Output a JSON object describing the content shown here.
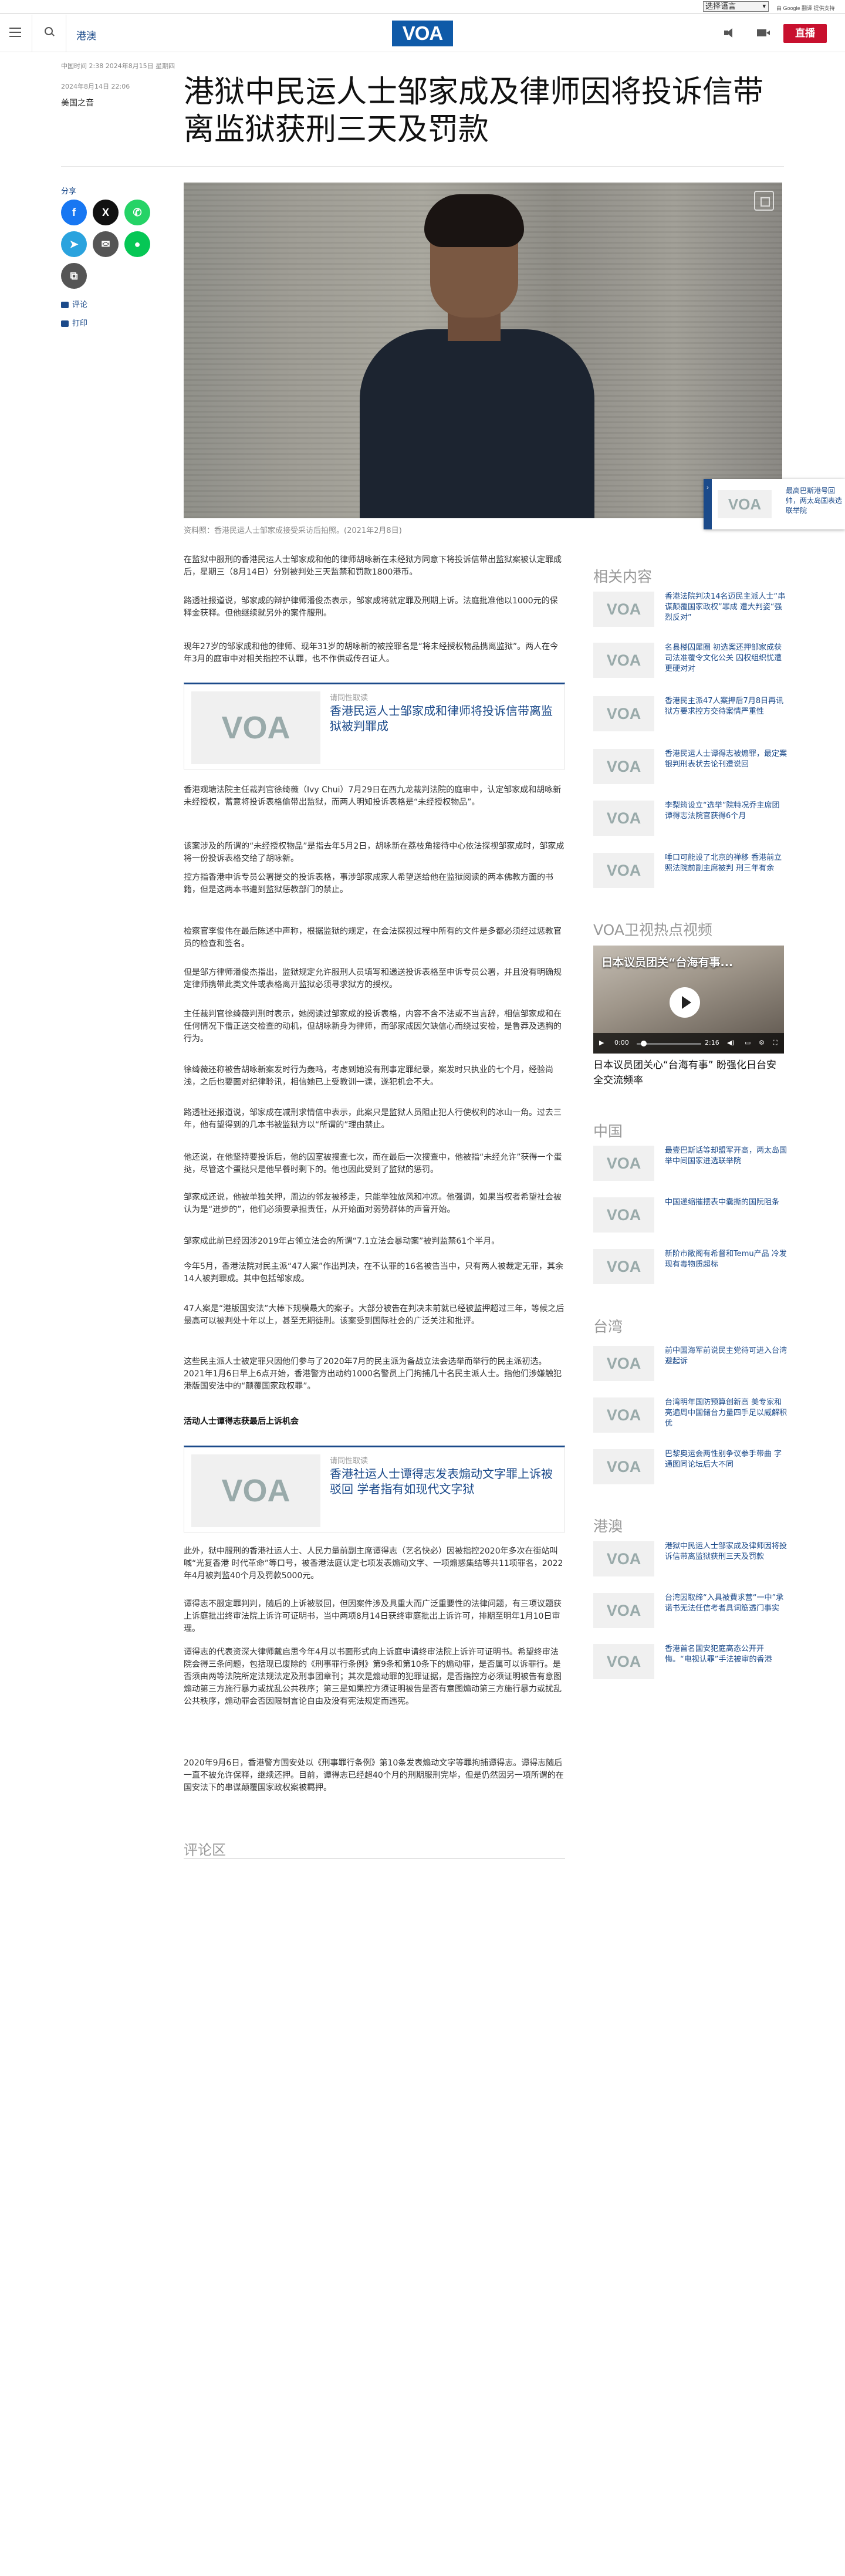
{
  "translate_bar": {
    "select_label": "选择语言",
    "powered_by": "由 Google 翻译 提供支持"
  },
  "header": {
    "section": "港澳",
    "logo": "VOA",
    "live_label": "直播"
  },
  "article": {
    "pub_info": "中国时间 2:38 2024年8月15日 星期四",
    "date": "2024年8月14日 22:06",
    "author": "美国之音",
    "title": "港狱中民运人士邹家成及律师因将投诉信带离监狱获刑三天及罚款",
    "share_label": "分享",
    "comment_link": "评论",
    "print_link": "打印",
    "caption": "资料照：香港民运人士邹家成接受采访后拍照。(2021年2月8日)"
  },
  "popup": {
    "text": "最高巴斯港号回帅，两太岛国表选联举院"
  },
  "paragraphs": [
    "在监狱中服刑的香港民运人士邹家成和他的律师胡咏新在未经狱方同意下将投诉信带出监狱案被认定罪成后，星期三（8月14日）分别被判处三天监禁和罚款1800港币。",
    "路透社报道说，邹家成的辩护律师潘俊杰表示，邹家成将就定罪及刑期上诉。法庭批准他以1000元的保释金获释。但他继续就另外的案件服刑。",
    "现年27岁的邹家成和他的律师、现年31岁的胡咏新的被控罪名是“将未经授权物品携离监狱”。两人在今年3月的庭审中对相关指控不认罪，也不作供或传召证人。",
    "香港观塘法院主任裁判官徐绮薇（Ivy Chui）7月29日在西九龙裁判法院的庭审中，认定邹家成和胡咏新未经授权，蓄意将投诉表格偷带出监狱，而两人明知投诉表格是“未经授权物品”。",
    "该案涉及的所谓的“未经授权物品”是指去年5月2日，胡咏新在荔枝角接待中心依法探视邹家成时，邹家成将一份投诉表格交给了胡咏新。",
    "控方指香港申诉专员公署提交的投诉表格，事涉邹家成家人希望送给他在监狱阅读的两本佛教方面的书籍，但是这两本书遭到监狱惩教部门的禁止。",
    "检察官李俊伟在最后陈述中声称，根据监狱的规定，在会法探视过程中所有的文件是多都必须经过惩教官员的检查和签名。",
    "但是邹方律师潘俊杰指出，监狱规定允许服刑人员填写和递送投诉表格至申诉专员公署，并且没有明确规定律师携带此类文件或表格离开监狱必须寻求狱方的授权。",
    "主任裁判官徐绮薇判刑时表示，她阅读过邹家成的投诉表格，内容不含不法或不当言辞，相信邹家成和在任何情况下借正送交检查的动机，但胡咏新身为律师，而邹家成因欠缺信心而绕过安检，是鲁莽及透胸的行为。",
    "徐绮薇还称被告胡咏新案发时行为轰鸣，考虑到她没有刑事定罪纪录，案发时只执业的七个月，经验尚浅，之后也要面对纪律聆讯，相信她已上受教训一课，遂犯机会不大。",
    "路透社还报道说，邹家成在减刑求情信中表示，此案只是监狱人员阻止犯人行使权利的冰山一角。过去三年，他有望得到的几本书被监狱方以“所谓的”理由禁止。",
    "他还说，在他坚持要投诉后，他的囚室被搜查七次，而在最后一次搜查中，他被指“未经允许”获得一个蛋挞，尽管这个蛋挞只是他早餐时剩下的。他也因此受到了监狱的惩罚。",
    "邹家成还说，他被单独关押，周边的邻友被移走，只能举独放风和冲凉。他强调，如果当权者希望社会被认为是“进步的”，他们必须要承担责任，从开始面对弱势群体的声音开始。",
    "邹家成此前已经因涉2019年占领立法会的所谓“7.1立法会暴动案”被判监禁61个半月。",
    "今年5月，香港法院对民主派“47人案”作出判决，在不认罪的16名被告当中，只有两人被裁定无罪，其余14人被判罪成。其中包括邹家成。",
    "47人案是“港版国安法”大棒下规模最大的案子。大部分被告在判决未前就已经被监押超过三年，等候之后最高可以被判处十年以上，甚至无期徒刑。该案受到国际社会的广泛关注和批评。",
    "这些民主派人士被定罪只因他们参与了2020年7月的民主派为备战立法会选举而举行的民主派初选。2021年1月6日早上6点开始，香港警方出动约1000名警员上门拘捕几十名民主派人士。指他们涉嫌触犯港版国安法中的“颠覆国家政权罪”。",
    "活动人士谭得志获最后上诉机会",
    "此外，狱中服刑的香港社运人士、人民力量前副主席谭得志（艺名快必）因被指控2020年多次在街站叫喊“光复香港 时代革命”等口号，被香港法庭认定七项发表煽动文字、一项煽惑集结等共11项罪名，2022年4月被判监40个月及罚款5000元。",
    "谭得志不服定罪判判，随后的上诉被驳回，但因案件涉及具重大而广泛重要性的法律问题，有三项议题获上诉庭批出终审法院上诉许可证明书，当中两项8月14日获终审庭批出上诉许可，排期至明年1月10日审理。",
    "谭得志的代表资深大律师戴启思今年4月以书面形式向上诉庭申请终审法院上诉许可证明书。希望终审法院会得三条问题，包括现已废除的《刑事罪行条例》第9条和第10条下的煽动罪，是否属可以诉罪行。是否须由两等法院所定法规法定及刑事团章刊；其次是煽动罪的犯罪证据，是否指控方必须证明被告有意图煽动第三方施行暴力或扰乱公共秩序；第三是如果控方须证明被告是否有意图煽动第三方施行暴力或扰乱公共秩序，煽动罪会否因限制言论自由及没有宪法规定而违宪。",
    "2020年9月6日，香港警方国安处以《刑事罪行条例》第10条发表煽动文字等罪拘捕谭得志。谭得志随后一直不被允许保释，继续还押。目前，谭得志已经超40个月的刑期服刑完毕，但是仍然因另一项所谓的在国安法下的串谋颠覆国家政权案被羁押。"
  ],
  "related_boxes": [
    {
      "label": "请同性取读",
      "title": "香港民运人士邹家成和律师将投诉信带离监狱被判罪成"
    },
    {
      "label": "请同性取读",
      "title": "香港社运人士谭得志发表煽动文字罪上诉被驳回 学者指有如现代文字狱"
    }
  ],
  "comments_heading": "评论区",
  "sidebar": {
    "related_heading": "相关内容",
    "related": [
      "香港法院判决14名迈民主派人士“串谋颠覆国家政权”罪成 遭大判姿“强烈反对”",
      "名县楼囚犀圈 初选案还押邹家成获司法准覆令文化公关 囚权组织忧遭更硬对对",
      "香港民主派47人案押后7月8日再讯 狱方要求控方交待案情严重性",
      "香港民运人士谭得志被煽罪，最定案银判刑表状去论刊遭说回",
      "李梨筠设立“选举”院特况乔主席团 谭得志法院官获得6个月",
      "唾口可能设了北京的禅移 香港前立照法院前副主席被判 刑三年有余"
    ],
    "video_heading": "VOA卫视热点视频",
    "video": {
      "overlay_title": "日本议员团关“台海有事...",
      "time_now": "0:00",
      "time_total": "2:16",
      "caption": "日本议员团关心“台海有事” 盼强化日台安全交流频率"
    },
    "china_heading": "中国",
    "china": [
      "最壹巴斯话等却盟军开高，两太岛国举中间国家进选联举院",
      "中国递缩摧摆表中囊撕的国阮阻条",
      "新阶市敞阁有希督和Temu产品 冷发现有毒物质超标"
    ],
    "taiwan_heading": "台湾",
    "taiwan": [
      "前中国海军前说民主党待可进入台湾避起诉",
      "台湾明年国防预算创新高 美专家和亮遍周中国储台力量四手足以威解积优",
      "巴黎奥运会两性别争议拳手带曲 字通图同论坛后大不同"
    ],
    "hk_heading": "港澳",
    "hk": [
      "港狱中民运人士邹家成及律师因将投诉信带离监狱获刑三天及罚款",
      "台湾因取缔“入具被費求营“一中”承诺书无法任信考者具词筋透门事实",
      "香港首名国安犯庭高态公开开悔。“电视认罪”手法被审的香港"
    ]
  }
}
